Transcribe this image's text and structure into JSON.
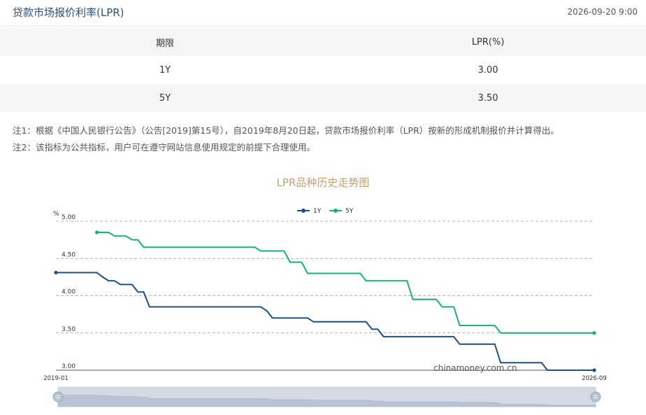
{
  "header": {
    "title": "贷款市场报价利率(LPR)",
    "date": "2026-09-20 9:00"
  },
  "table": {
    "headers": [
      "期限",
      "LPR(%)"
    ],
    "rows": [
      {
        "term": "1Y",
        "rate": "3.00"
      },
      {
        "term": "5Y",
        "rate": "3.50"
      }
    ]
  },
  "notes": [
    "注1：根据《中国人民银行公告》（公告[2019]第15号），自2019年8月20日起，贷款市场报价利率（LPR）按新的形成机制报价并计算得出。",
    "注2：该指标为公共指标，用户可在遵守网站信息使用规定的前提下合理使用。"
  ],
  "watermark": "chinamoney.com.cn",
  "colors": {
    "series_1y": "#1d4f86",
    "series_5y": "#17b07d",
    "title": "#c0a172"
  },
  "chart_data": {
    "type": "line",
    "title": "LPR品种历史走势图",
    "ylabel": "%",
    "ylim": [
      3.0,
      5.0
    ],
    "yticks": [
      "5.00",
      "4.50",
      "4.00",
      "3.50",
      "3.00"
    ],
    "xtick_labels": [
      "2019-01",
      "2026-09"
    ],
    "legend": "top-center",
    "grid": "horizontal dashed",
    "series": [
      {
        "name": "1Y",
        "color": "#1d4f86",
        "points": [
          [
            "2019-01",
            4.31
          ],
          [
            "2019-08",
            4.31
          ],
          [
            "2019-09",
            4.25
          ],
          [
            "2019-10",
            4.2
          ],
          [
            "2019-11",
            4.2
          ],
          [
            "2019-12",
            4.15
          ],
          [
            "2020-01",
            4.15
          ],
          [
            "2020-02",
            4.15
          ],
          [
            "2020-03",
            4.05
          ],
          [
            "2020-04",
            4.05
          ],
          [
            "2020-05",
            3.85
          ],
          [
            "2021-12",
            3.85
          ],
          [
            "2022-01",
            3.8
          ],
          [
            "2022-02",
            3.7
          ],
          [
            "2022-08",
            3.7
          ],
          [
            "2022-09",
            3.65
          ],
          [
            "2023-06",
            3.65
          ],
          [
            "2023-07",
            3.55
          ],
          [
            "2023-08",
            3.55
          ],
          [
            "2023-09",
            3.45
          ],
          [
            "2024-09",
            3.45
          ],
          [
            "2024-10",
            3.35
          ],
          [
            "2025-04",
            3.35
          ],
          [
            "2025-05",
            3.1
          ],
          [
            "2025-12",
            3.1
          ],
          [
            "2026-01",
            3.0
          ],
          [
            "2026-09",
            3.0
          ]
        ]
      },
      {
        "name": "5Y",
        "color": "#17b07d",
        "points": [
          [
            "2019-08",
            4.85
          ],
          [
            "2019-10",
            4.85
          ],
          [
            "2019-11",
            4.8
          ],
          [
            "2020-01",
            4.8
          ],
          [
            "2020-02",
            4.75
          ],
          [
            "2020-03",
            4.75
          ],
          [
            "2020-04",
            4.65
          ],
          [
            "2021-11",
            4.65
          ],
          [
            "2021-12",
            4.6
          ],
          [
            "2022-04",
            4.6
          ],
          [
            "2022-05",
            4.45
          ],
          [
            "2022-07",
            4.45
          ],
          [
            "2022-08",
            4.3
          ],
          [
            "2023-05",
            4.3
          ],
          [
            "2023-06",
            4.2
          ],
          [
            "2024-01",
            4.2
          ],
          [
            "2024-02",
            3.95
          ],
          [
            "2024-06",
            3.95
          ],
          [
            "2024-07",
            3.85
          ],
          [
            "2024-09",
            3.85
          ],
          [
            "2024-10",
            3.6
          ],
          [
            "2025-04",
            3.6
          ],
          [
            "2025-05",
            3.5
          ],
          [
            "2026-09",
            3.5
          ]
        ]
      }
    ]
  }
}
